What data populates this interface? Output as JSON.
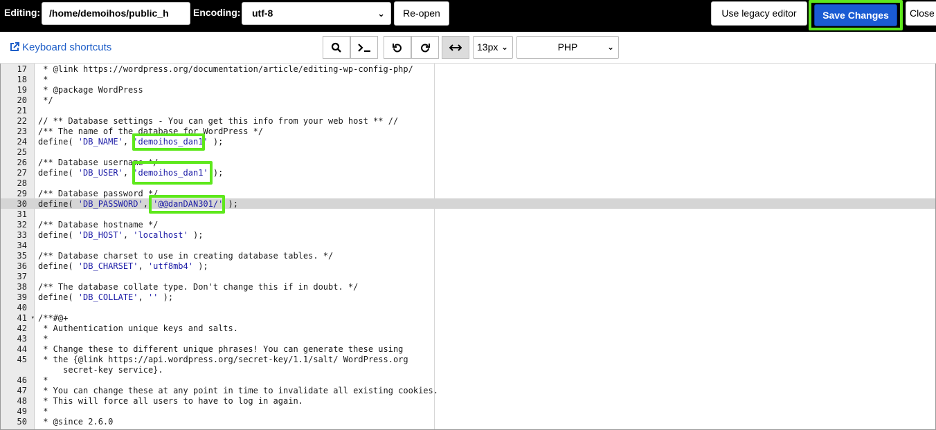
{
  "topbar": {
    "editing_label": "Editing:",
    "file_path": "/home/demoihos/public_h",
    "encoding_label": "Encoding:",
    "encoding_value": "utf-8",
    "reopen_label": "Re-open",
    "legacy_label": "Use legacy editor",
    "save_label": "Save Changes",
    "close_label": "Close"
  },
  "toolbar": {
    "keyboard_shortcuts": "Keyboard shortcuts",
    "icons": [
      "search-icon",
      "terminal-icon",
      "undo-icon",
      "redo-icon",
      "wrap-icon",
      "external-link-icon"
    ],
    "font_size": "13px",
    "mode": "PHP"
  },
  "colors": {
    "accent": "#1a5bd3",
    "highlight": "#5ee81c",
    "string": "#1a1aa6",
    "link": "#1e5ec8"
  },
  "editor": {
    "current_line": "30",
    "lines": [
      {
        "n": "17",
        "t": " * @link https://wordpress.org/documentation/article/editing-wp-config-php/"
      },
      {
        "n": "18",
        "t": " *"
      },
      {
        "n": "19",
        "t": " * @package WordPress"
      },
      {
        "n": "20",
        "t": " */"
      },
      {
        "n": "21",
        "t": ""
      },
      {
        "n": "22",
        "t": "// ** Database settings - You can get this info from your web host ** //"
      },
      {
        "n": "23",
        "t": "/** The name of the database for WordPress */"
      },
      {
        "n": "24",
        "t": "define( 'DB_NAME', 'demoihos_dan1' );"
      },
      {
        "n": "25",
        "t": ""
      },
      {
        "n": "26",
        "t": "/** Database username */"
      },
      {
        "n": "27",
        "t": "define( 'DB_USER', 'demoihos_dan1' );"
      },
      {
        "n": "28",
        "t": ""
      },
      {
        "n": "29",
        "t": "/** Database password */"
      },
      {
        "n": "30",
        "t": "define( 'DB_PASSWORD', '@@danDAN301/' );"
      },
      {
        "n": "31",
        "t": ""
      },
      {
        "n": "32",
        "t": "/** Database hostname */"
      },
      {
        "n": "33",
        "t": "define( 'DB_HOST', 'localhost' );"
      },
      {
        "n": "34",
        "t": ""
      },
      {
        "n": "35",
        "t": "/** Database charset to use in creating database tables. */"
      },
      {
        "n": "36",
        "t": "define( 'DB_CHARSET', 'utf8mb4' );"
      },
      {
        "n": "37",
        "t": ""
      },
      {
        "n": "38",
        "t": "/** The database collate type. Don't change this if in doubt. */"
      },
      {
        "n": "39",
        "t": "define( 'DB_COLLATE', '' );"
      },
      {
        "n": "40",
        "t": ""
      },
      {
        "n": "41",
        "t": "/**#@+"
      },
      {
        "n": "42",
        "t": " * Authentication unique keys and salts."
      },
      {
        "n": "43",
        "t": " *"
      },
      {
        "n": "44",
        "t": " * Change these to different unique phrases! You can generate these using"
      },
      {
        "n": "45",
        "t": " * the {@link https://api.wordpress.org/secret-key/1.1/salt/ WordPress.org"
      },
      {
        "n": "",
        "t": "     secret-key service}."
      },
      {
        "n": "46",
        "t": " *"
      },
      {
        "n": "47",
        "t": " * You can change these at any point in time to invalidate all existing cookies."
      },
      {
        "n": "48",
        "t": " * This will force all users to have to log in again."
      },
      {
        "n": "49",
        "t": " *"
      },
      {
        "n": "50",
        "t": " * @since 2.6.0"
      }
    ]
  }
}
